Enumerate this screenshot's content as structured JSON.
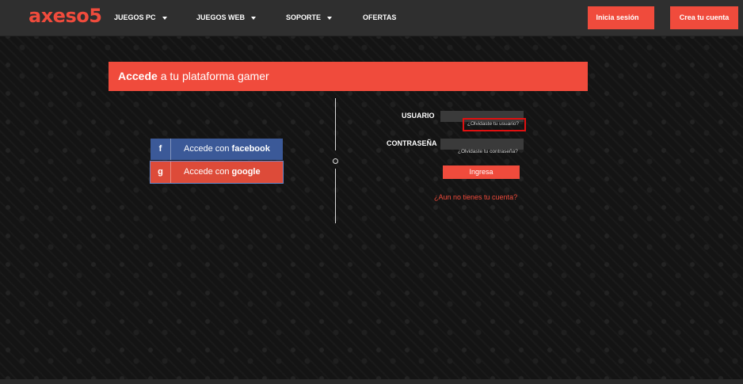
{
  "header": {
    "logo_text": "axeso5",
    "nav": [
      {
        "label": "JUEGOS PC"
      },
      {
        "label": "JUEGOS WEB"
      },
      {
        "label": "SOPORTE"
      },
      {
        "label": "OFERTAS"
      }
    ],
    "login_button": "Inicia sesión",
    "signup_button": "Crea tu cuenta"
  },
  "banner": {
    "strong": "Accede",
    "rest": "a tu plataforma gamer"
  },
  "social": {
    "facebook": {
      "icon": "f",
      "prefix": "Accede con",
      "brand": "facebook"
    },
    "google": {
      "icon": "g",
      "prefix": "Accede con",
      "brand": "google"
    }
  },
  "form": {
    "username_label": "USUARIO",
    "username_value": "",
    "forgot_user": "¿Olvidaste tu usuario?",
    "password_label": "CONTRASEÑA",
    "password_value": "",
    "forgot_password": "¿Olvidaste tu contraseña?",
    "submit": "Ingresa",
    "no_account": "¿Aun no tienes tu cuenta?"
  },
  "colors": {
    "accent": "#f04b3c",
    "facebook": "#3b5998",
    "google": "#dd4b39",
    "header_bg": "#2f2f2f",
    "highlight": "#e01010"
  }
}
